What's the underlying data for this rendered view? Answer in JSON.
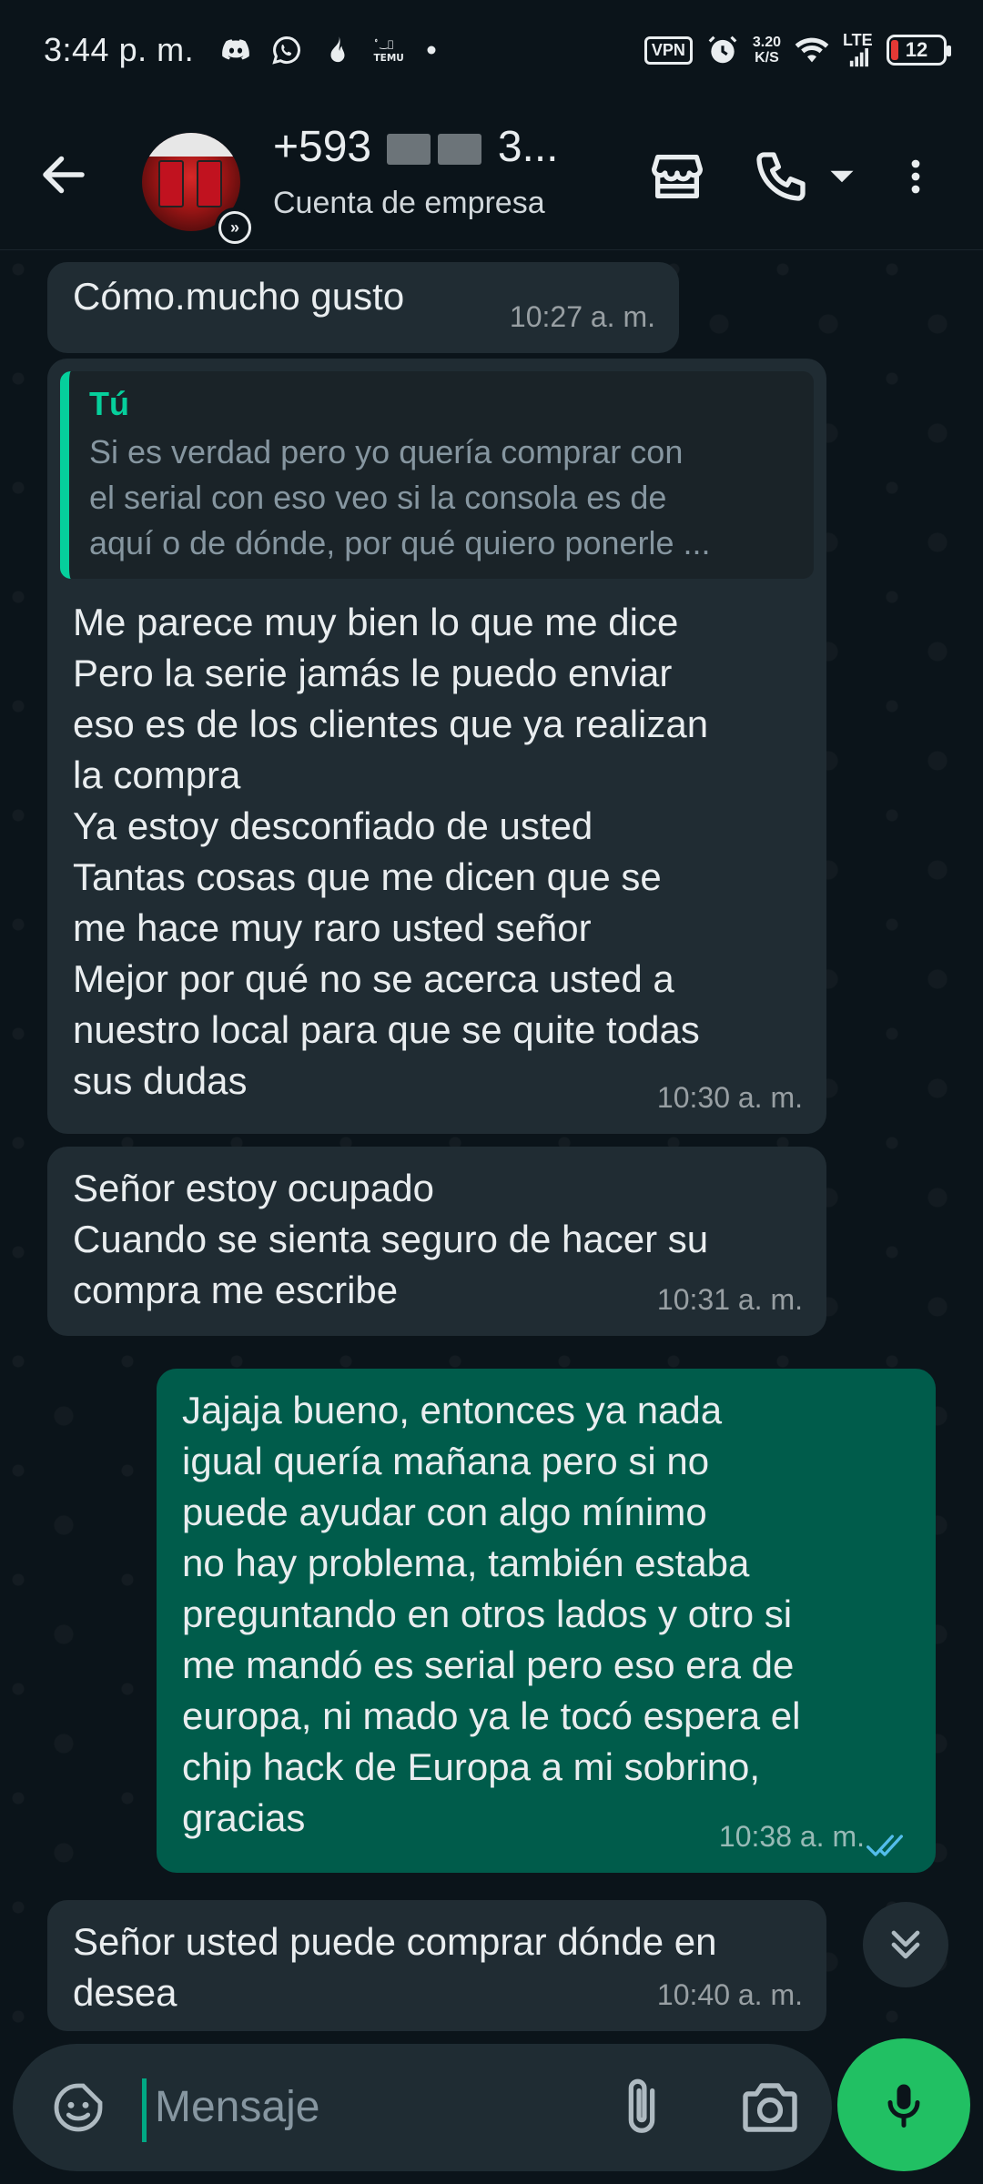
{
  "status_bar": {
    "time": "3:44 p. m.",
    "vpn": "VPN",
    "speed_value": "3.20",
    "speed_unit": "K/S",
    "network": "LTE",
    "battery": "12",
    "icons": [
      "discord-icon",
      "whatsapp-icon",
      "flame-icon",
      "temu-icon",
      "dot-icon",
      "alarm-icon",
      "wifi-icon",
      "signal-icon"
    ]
  },
  "header": {
    "contact_prefix": "+593",
    "contact_suffix": "3...",
    "subtitle": "Cuenta de empresa"
  },
  "messages": [
    {
      "direction": "in",
      "text": "Cómo.mucho gusto",
      "time": "10:27 a. m."
    },
    {
      "direction": "in",
      "reply": {
        "author": "Tú",
        "line1": "Si es verdad pero yo quería comprar con",
        "line2": "el serial con eso veo si la consola es de",
        "line3": "aquí o de dónde, por qué quiero ponerle ..."
      },
      "text": "Me parece muy bien lo que me dice\nPero la serie jamás le puedo enviar\neso es de los clientes que ya realizan\nla compra\nYa estoy desconfiado de usted\nTantas cosas que me dicen que se\nme hace muy raro usted señor\nMejor por qué no se acerca usted a\nnuestro local para que se quite todas\nsus dudas",
      "time": "10:30 a. m."
    },
    {
      "direction": "in",
      "text": "Señor estoy ocupado\nCuando se sienta seguro de hacer su\ncompra me escribe",
      "time": "10:31 a. m."
    },
    {
      "direction": "out",
      "text": "Jajaja bueno, entonces ya nada\nigual quería mañana pero si no\npuede ayudar con algo mínimo\nno hay problema, también estaba\npreguntando en otros lados y otro si\nme mandó es serial pero eso era de\neuropa, ni mado ya le tocó espera el\nchip hack de Europa a mi sobrino,\ngracias",
      "time": "10:38 a. m.",
      "status": "read"
    },
    {
      "direction": "in",
      "text": "Señor usted puede comprar dónde en\ndesea",
      "time": "10:40 a. m."
    }
  ],
  "input": {
    "placeholder": "Mensaje"
  },
  "colors": {
    "background": "#0b141a",
    "incoming_bubble": "#202c33",
    "outgoing_bubble": "#005c4b",
    "accent": "#00a884",
    "mic_button": "#21c063",
    "read_ticks": "#53bdeb"
  }
}
